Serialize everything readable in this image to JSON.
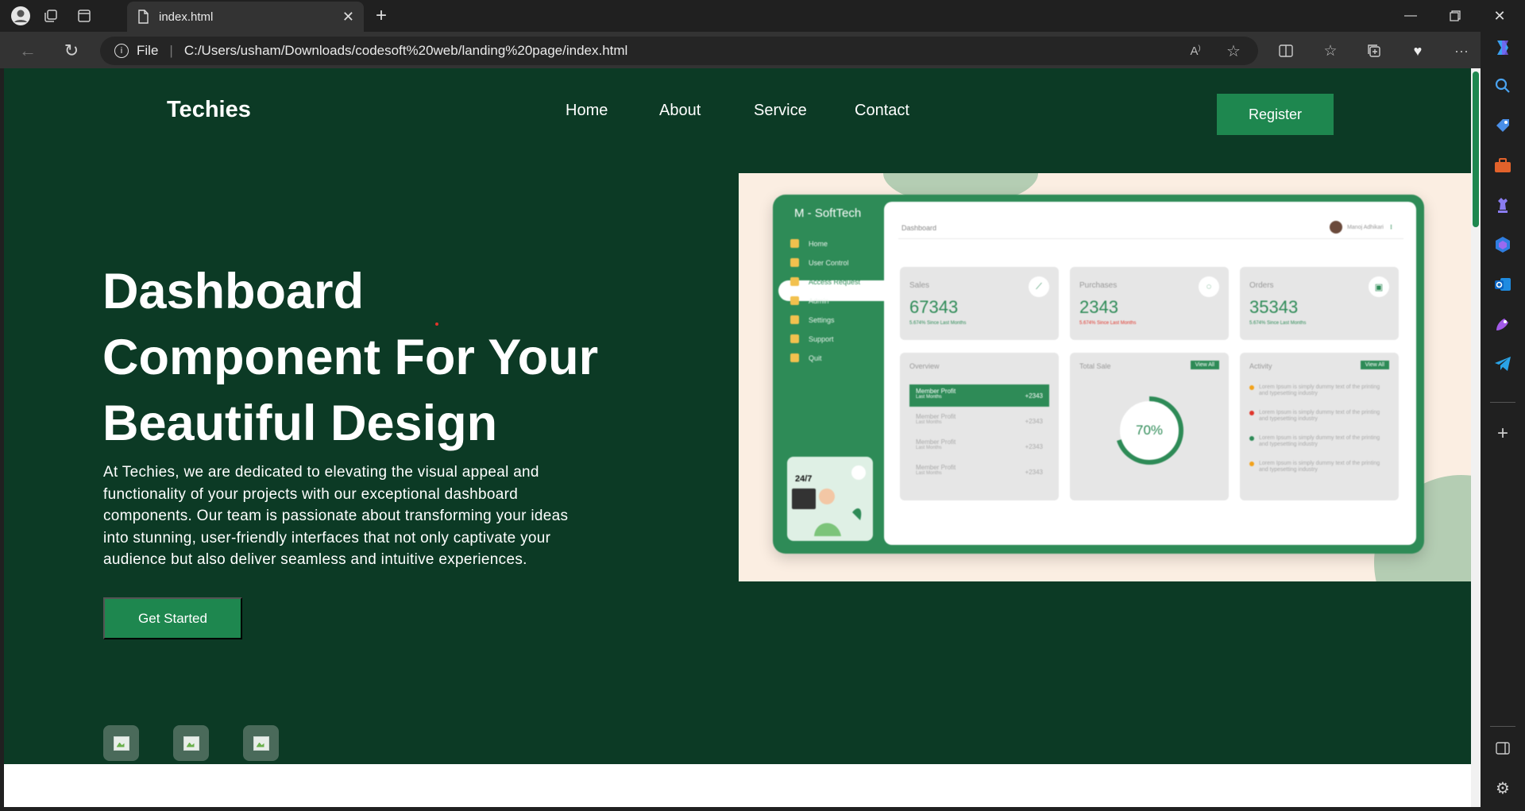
{
  "browser": {
    "tab_title": "index.html",
    "protocol_label": "File",
    "url": "C:/Users/usham/Downloads/codesoft%20web/landing%20page/index.html"
  },
  "site": {
    "logo": "Techies",
    "nav": [
      "Home",
      "About",
      "Service",
      "Contact"
    ],
    "register_label": "Register"
  },
  "hero": {
    "title_lines": [
      "Dashboard",
      "Component For Your",
      "Beautiful Design"
    ],
    "paragraph_lines": [
      "At Techies, we are dedicated to elevating the visual appeal and",
      "functionality of your projects with our exceptional dashboard",
      "components. Our team is passionate about transforming your ideas",
      "into stunning, user-friendly interfaces that not only captivate your",
      "audience but also deliver seamless and intuitive experiences."
    ],
    "cta": "Get Started"
  },
  "dashboard_image": {
    "brand": "M - SoftTech",
    "menu": [
      "Home",
      "User Control",
      "Access Request",
      "Admin",
      "Settings",
      "Support",
      "Quit"
    ],
    "header_title": "Dashboard",
    "user_name": "Manoj Adhikari",
    "stats": [
      {
        "label": "Sales",
        "value": "67343",
        "sub": "5.674% Since Last Months"
      },
      {
        "label": "Purchases",
        "value": "2343",
        "sub": "5.674% Since Last Months"
      },
      {
        "label": "Orders",
        "value": "35343",
        "sub": "5.674% Since Last Months"
      }
    ],
    "overview": {
      "title": "Overview",
      "rows": [
        {
          "name": "Member Profit",
          "sub": "Last Months",
          "amount": "+2343"
        },
        {
          "name": "Member Profit",
          "sub": "Last Months",
          "amount": "+2343"
        },
        {
          "name": "Member Profit",
          "sub": "Last Months",
          "amount": "+2343"
        },
        {
          "name": "Member Profit",
          "sub": "Last Months",
          "amount": "+2343"
        }
      ]
    },
    "total_sale": {
      "title": "Total Sale",
      "view_all": "View All",
      "percent": "70%",
      "fraction": 0.7
    },
    "activity": {
      "title": "Activity",
      "view_all": "View All",
      "items": [
        {
          "text": "Lorem Ipsum is simply dummy text of the printing and typesetting industry",
          "color": "#f2a21b"
        },
        {
          "text": "Lorem Ipsum is simply dummy text of the printing and typesetting industry",
          "color": "#e0352b"
        },
        {
          "text": "Lorem Ipsum is simply dummy text of the printing and typesetting industry",
          "color": "#2e8b57"
        },
        {
          "text": "Lorem Ipsum is simply dummy text of the printing and typesetting industry",
          "color": "#f2a21b"
        }
      ]
    },
    "help_badge": "24/7"
  },
  "colors": {
    "page_bg": "#0c3a25",
    "accent": "#1e874f",
    "mock_bg": "#fbeee2"
  }
}
